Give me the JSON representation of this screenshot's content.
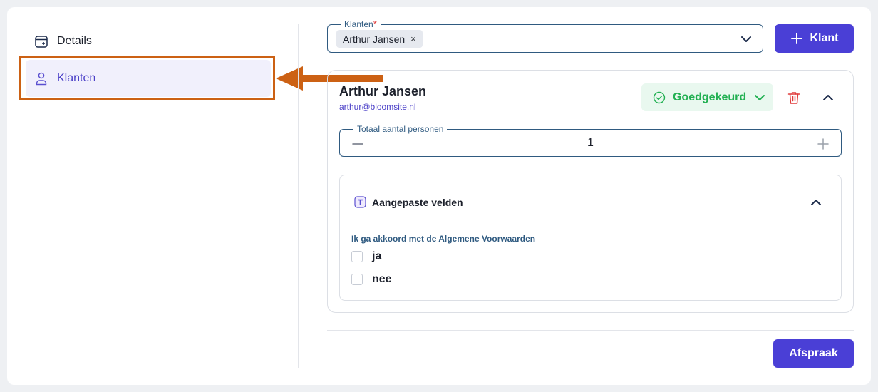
{
  "sidebar": {
    "items": [
      {
        "label": "Details",
        "icon": "calendar-add-icon",
        "active": false
      },
      {
        "label": "Klanten",
        "icon": "user-icon",
        "active": true
      }
    ]
  },
  "klanten_field": {
    "legend": "Klanten",
    "required_mark": "*",
    "selected_chip": "Arthur Jansen",
    "chip_remove": "×"
  },
  "add_client_button": {
    "label": "Klant"
  },
  "client": {
    "name": "Arthur Jansen",
    "email": "arthur@bloomsite.nl",
    "status": "Goedgekeurd",
    "persons_legend": "Totaal aantal personen",
    "persons_value": "1"
  },
  "custom_fields": {
    "title": "Aangepaste velden",
    "question": "Ik ga akkoord met de Algemene Voorwaarden",
    "options": [
      "ja",
      "nee"
    ]
  },
  "footer": {
    "submit_label": "Afspraak"
  },
  "colors": {
    "primary": "#4a3fd6",
    "active_nav_bg": "#f1f0fc",
    "status_green": "#22b052",
    "status_bg": "#e9f8ef",
    "danger": "#e03b3b",
    "annotation": "#cc6114"
  }
}
